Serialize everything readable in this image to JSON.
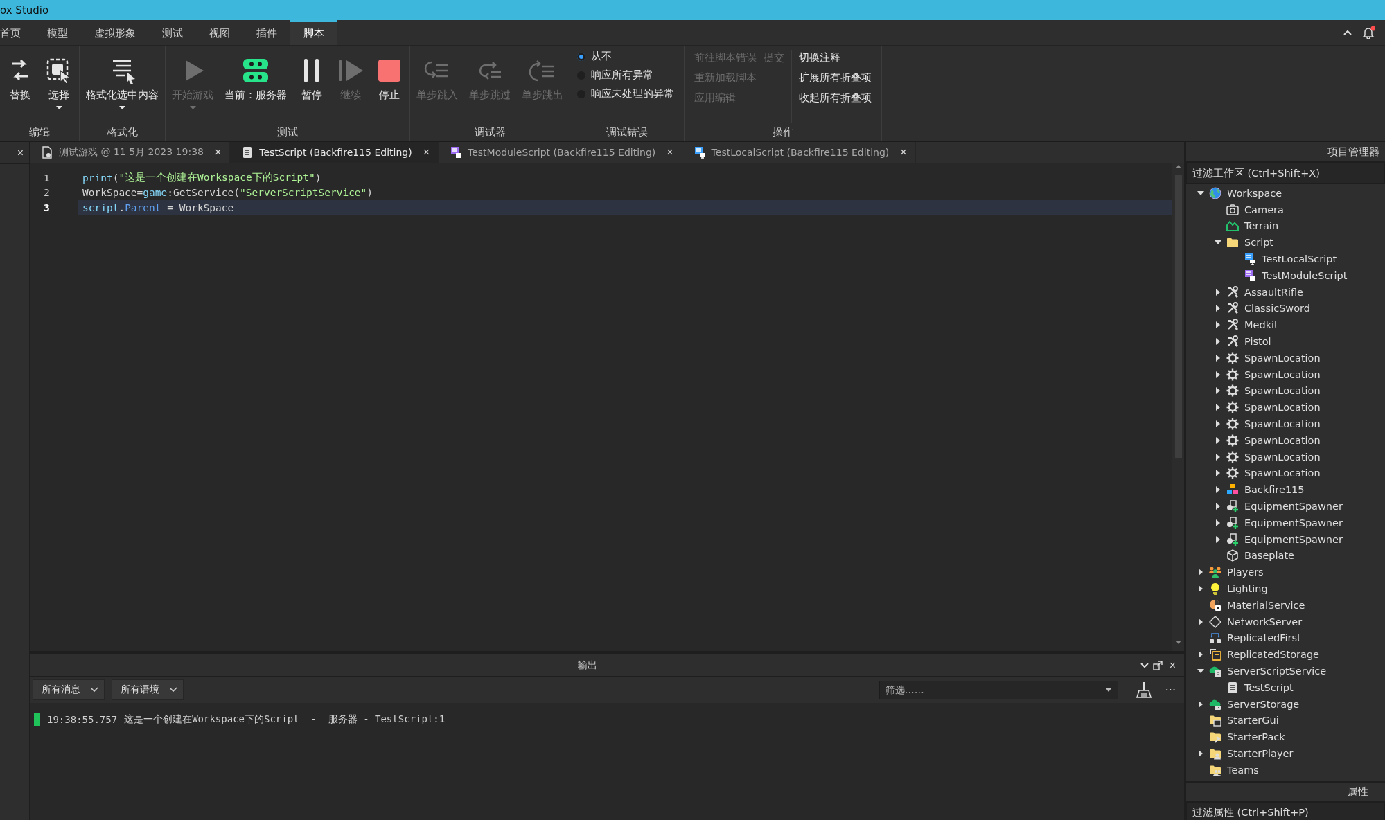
{
  "window": {
    "title": "ox Studio"
  },
  "menu_tabs": [
    {
      "label": "首页",
      "selected": false
    },
    {
      "label": "模型",
      "selected": false
    },
    {
      "label": "虚拟形象",
      "selected": false
    },
    {
      "label": "测试",
      "selected": false
    },
    {
      "label": "视图",
      "selected": false
    },
    {
      "label": "插件",
      "selected": false
    },
    {
      "label": "脚本",
      "selected": true
    }
  ],
  "notifications": {
    "unread": true
  },
  "ribbon": [
    {
      "label": "编辑",
      "kind": "buttons",
      "items": [
        {
          "label": "替换",
          "disabled": false,
          "dropdown": false
        },
        {
          "label": "选择",
          "disabled": false,
          "dropdown": true
        }
      ]
    },
    {
      "label": "格式化",
      "kind": "buttons",
      "items": [
        {
          "label": "格式化选中内容",
          "disabled": false,
          "dropdown": true
        }
      ]
    },
    {
      "label": "测试",
      "kind": "buttons",
      "items": [
        {
          "label": "开始游戏",
          "disabled": true,
          "dropdown": true
        },
        {
          "label": "当前：服务器",
          "disabled": false,
          "dropdown": false
        },
        {
          "label": "暂停",
          "disabled": false,
          "dropdown": false
        },
        {
          "label": "继续",
          "disabled": true,
          "dropdown": false
        },
        {
          "label": "停止",
          "disabled": false,
          "dropdown": false
        }
      ]
    },
    {
      "label": "调试器",
      "kind": "buttons",
      "items": [
        {
          "label": "单步跳入",
          "disabled": true,
          "dropdown": false
        },
        {
          "label": "单步跳过",
          "disabled": true,
          "dropdown": false
        },
        {
          "label": "单步跳出",
          "disabled": true,
          "dropdown": false
        }
      ]
    },
    {
      "label": "调试错误",
      "kind": "radios",
      "items": [
        {
          "label": "从不",
          "selected": true
        },
        {
          "label": "响应所有异常",
          "selected": false
        },
        {
          "label": "响应未处理的异常",
          "selected": false
        }
      ]
    },
    {
      "label": "操作",
      "kind": "columns",
      "columns": [
        [
          [
            {
              "label": "前往脚本错误",
              "disabled": true
            },
            {
              "label": "提交",
              "disabled": true
            }
          ],
          [
            {
              "label": "重新加载脚本",
              "disabled": true
            }
          ],
          [
            {
              "label": "应用编辑",
              "disabled": true
            }
          ]
        ],
        [
          [
            {
              "label": "切换注释",
              "disabled": false
            }
          ],
          [
            {
              "label": "扩展所有折叠项",
              "disabled": false
            }
          ],
          [
            {
              "label": "收起所有折叠项",
              "disabled": false
            }
          ]
        ]
      ]
    }
  ],
  "side_strip": {
    "close": "×"
  },
  "doc_tabs": [
    {
      "label": "测试游戏 @ 11 5月 2023 19:38",
      "selected": false,
      "close": "×"
    },
    {
      "label": "TestScript (Backfire115 Editing)",
      "selected": true,
      "close": "×"
    },
    {
      "label": "TestModuleScript (Backfire115 Editing)",
      "selected": false,
      "close": "×"
    },
    {
      "label": "TestLocalScript (Backfire115 Editing)",
      "selected": false,
      "close": "×"
    }
  ],
  "editor": {
    "lines": [
      {
        "number": "1",
        "current": false,
        "tokens": [
          {
            "text": "print",
            "kind": "builtin"
          },
          {
            "text": "(",
            "kind": "plain"
          },
          {
            "text": "\"这是一个创建在Workspace下的Script\"",
            "kind": "string"
          },
          {
            "text": ")",
            "kind": "plain"
          }
        ]
      },
      {
        "number": "2",
        "current": false,
        "tokens": [
          {
            "text": "WorkSpace=",
            "kind": "plain"
          },
          {
            "text": "game",
            "kind": "builtin"
          },
          {
            "text": ":GetService(",
            "kind": "plain"
          },
          {
            "text": "\"ServerScriptService\"",
            "kind": "string"
          },
          {
            "text": ")",
            "kind": "plain"
          }
        ]
      },
      {
        "number": "3",
        "current": true,
        "tokens": [
          {
            "text": "script",
            "kind": "builtin"
          },
          {
            "text": ".",
            "kind": "plain"
          },
          {
            "text": "Parent",
            "kind": "property"
          },
          {
            "text": " = WorkSpace",
            "kind": "plain"
          }
        ]
      }
    ]
  },
  "output": {
    "title": "输出",
    "close": "×",
    "filters": [
      {
        "label": "所有消息"
      },
      {
        "label": "所有语境"
      }
    ],
    "search": {
      "placeholder": "筛选……"
    },
    "more": "···",
    "messages": [
      {
        "time": "19:38:55.757",
        "text": "这是一个创建在Workspace下的Script  -  服务器 - TestScript:1",
        "color": "#1fc35a"
      }
    ]
  },
  "explorer": {
    "title": "项目管理器",
    "filter": {
      "placeholder": "过滤工作区 (Ctrl+Shift+X)"
    },
    "items": [
      {
        "label": "Workspace",
        "expanded": true,
        "children": [
          {
            "label": "Camera"
          },
          {
            "label": "Terrain"
          },
          {
            "label": "Script",
            "expanded": true,
            "children": [
              {
                "label": "TestLocalScript"
              },
              {
                "label": "TestModuleScript"
              }
            ]
          },
          {
            "label": "AssaultRifle",
            "expanded": false
          },
          {
            "label": "ClassicSword",
            "expanded": false
          },
          {
            "label": "Medkit",
            "expanded": false
          },
          {
            "label": "Pistol",
            "expanded": false
          },
          {
            "label": "SpawnLocation",
            "expanded": false
          },
          {
            "label": "SpawnLocation",
            "expanded": false
          },
          {
            "label": "SpawnLocation",
            "expanded": false
          },
          {
            "label": "SpawnLocation",
            "expanded": false
          },
          {
            "label": "SpawnLocation",
            "expanded": false
          },
          {
            "label": "SpawnLocation",
            "expanded": false
          },
          {
            "label": "SpawnLocation",
            "expanded": false
          },
          {
            "label": "SpawnLocation",
            "expanded": false
          },
          {
            "label": "Backfire115",
            "expanded": false
          },
          {
            "label": "EquipmentSpawner",
            "expanded": false
          },
          {
            "label": "EquipmentSpawner",
            "expanded": false
          },
          {
            "label": "EquipmentSpawner",
            "expanded": false
          },
          {
            "label": "Baseplate"
          }
        ]
      },
      {
        "label": "Players",
        "expanded": false
      },
      {
        "label": "Lighting",
        "expanded": false
      },
      {
        "label": "MaterialService"
      },
      {
        "label": "NetworkServer",
        "expanded": false
      },
      {
        "label": "ReplicatedFirst"
      },
      {
        "label": "ReplicatedStorage",
        "expanded": false
      },
      {
        "label": "ServerScriptService",
        "expanded": true,
        "children": [
          {
            "label": "TestScript"
          }
        ]
      },
      {
        "label": "ServerStorage",
        "expanded": false
      },
      {
        "label": "StarterGui"
      },
      {
        "label": "StarterPack"
      },
      {
        "label": "StarterPlayer",
        "expanded": false
      },
      {
        "label": "Teams"
      }
    ]
  },
  "properties": {
    "title": "属性",
    "filter": {
      "placeholder": "过滤属性 (Ctrl+Shift+P)"
    }
  }
}
